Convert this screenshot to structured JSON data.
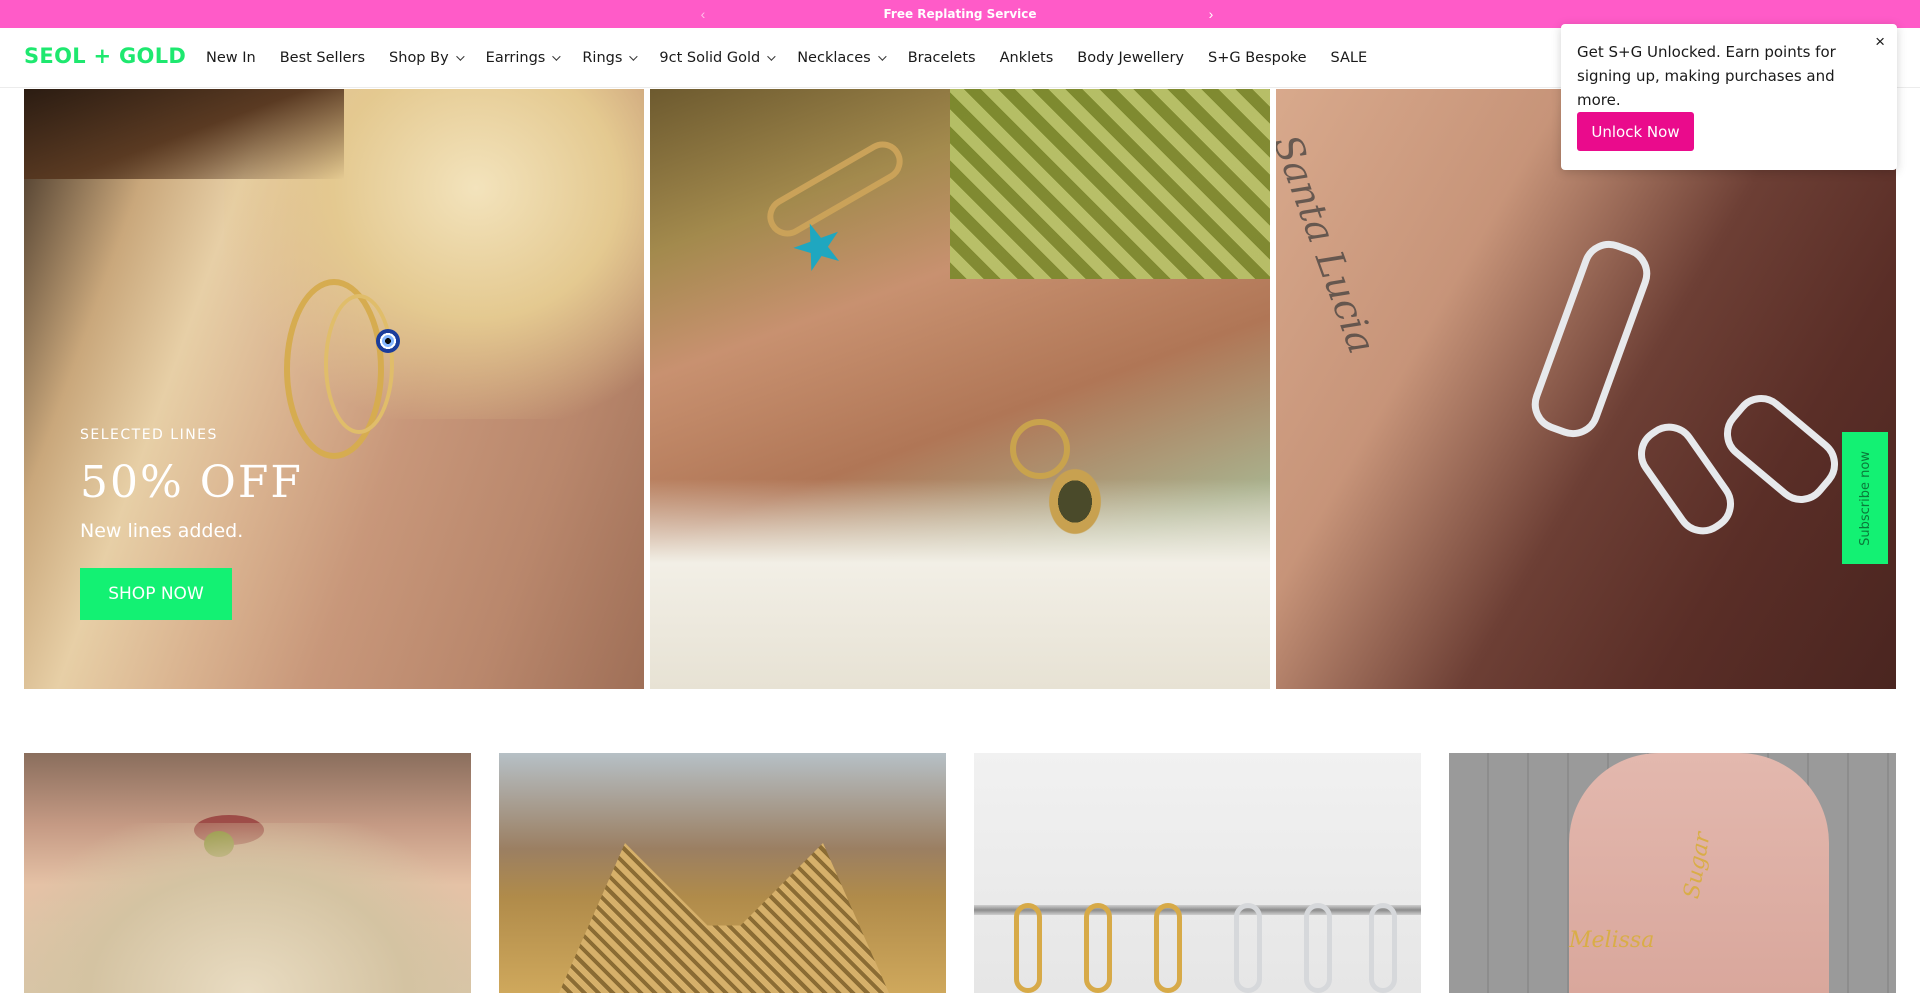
{
  "announcement": {
    "text": "Free Replating Service",
    "prev_icon": "‹",
    "next_icon": "›"
  },
  "header": {
    "logo": "SEOL + GOLD",
    "nav": [
      {
        "label": "New In",
        "has_dropdown": false
      },
      {
        "label": "Best Sellers",
        "has_dropdown": false
      },
      {
        "label": "Shop By",
        "has_dropdown": true
      },
      {
        "label": "Earrings",
        "has_dropdown": true
      },
      {
        "label": "Rings",
        "has_dropdown": true
      },
      {
        "label": "9ct Solid Gold",
        "has_dropdown": true
      },
      {
        "label": "Necklaces",
        "has_dropdown": true
      },
      {
        "label": "Bracelets",
        "has_dropdown": false
      },
      {
        "label": "Anklets",
        "has_dropdown": false
      },
      {
        "label": "Body Jewellery",
        "has_dropdown": false
      },
      {
        "label": "S+G Bespoke",
        "has_dropdown": false
      },
      {
        "label": "SALE",
        "has_dropdown": false
      }
    ]
  },
  "hero": {
    "eyebrow": "SELECTED LINES",
    "headline": "50% OFF",
    "subline": "New lines added.",
    "cta": "SHOP NOW"
  },
  "popup": {
    "text": "Get S+G Unlocked. Earn points for signing up, making purchases and more.",
    "close": "×",
    "button": "Unlock Now"
  },
  "subscribe_tab": "Subscribe now",
  "decorative_text": {
    "tattoo": "Santa Lucia",
    "name_plate_1": "Melissa",
    "name_plate_2": "Sugar"
  },
  "colors": {
    "announcement_bg": "#ff5bc8",
    "brand_green": "#13f173",
    "unlock_pink": "#ea0b8c"
  }
}
